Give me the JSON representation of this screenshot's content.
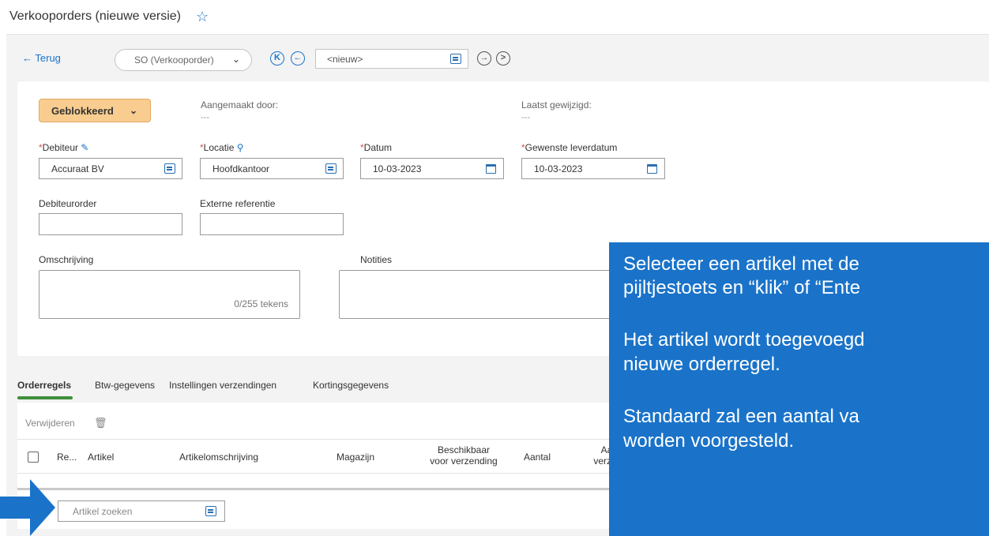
{
  "page": {
    "title": "Verkooporders (nieuwe versie)"
  },
  "nav": {
    "back_label": "Terug",
    "order_type": "SO (Verkooporder)",
    "record_value": "<nieuw>"
  },
  "header": {
    "status": "Geblokkeerd",
    "created_by_label": "Aangemaakt door:",
    "created_by_value": "---",
    "modified_label": "Laatst gewijzigd:",
    "modified_value": "---"
  },
  "form": {
    "debiteur_label": "Debiteur",
    "debiteur_value": "Accuraat BV",
    "locatie_label": "Locatie",
    "locatie_value": "Hoofdkantoor",
    "datum_label": "Datum",
    "datum_value": "10-03-2023",
    "leverdatum_label": "Gewenste leverdatum",
    "leverdatum_value": "10-03-2023",
    "debiteurorder_label": "Debiteurorder",
    "externe_ref_label": "Externe referentie",
    "omschrijving_label": "Omschrijving",
    "omschrijving_counter": "0/255 tekens",
    "notities_label": "Notities",
    "required_marker": "*"
  },
  "tabs": [
    {
      "label": "Orderregels"
    },
    {
      "label": "Btw-gegevens"
    },
    {
      "label": "Instellingen verzendingen"
    },
    {
      "label": "Kortingsgegevens"
    }
  ],
  "grid": {
    "delete_label": "Verwijderen",
    "columns": {
      "re": "Re...",
      "artikel": "Artikel",
      "omschrijving": "Artikelomschrijving",
      "magazijn": "Magazijn",
      "beschikbaar_1": "Beschikbaar",
      "beschikbaar_2": "voor verzending",
      "aantal": "Aantal",
      "aantal_verz_1": "Aa",
      "aantal_verz_2": "verzer"
    },
    "search_placeholder": "Artikel zoeken"
  },
  "tooltip": {
    "lines": [
      "Selecteer een artikel met de",
      "pijltjestoets en “klik” of “Ente",
      "Het artikel wordt toegevoegd",
      "nieuwe orderregel.",
      "Standaard zal een aantal va",
      "worden voorgesteld."
    ]
  },
  "colors": {
    "accent": "#1a73c9",
    "status_bg": "#f9cd8f",
    "tab_active": "#3f8f3c",
    "required": "#d9534f"
  }
}
